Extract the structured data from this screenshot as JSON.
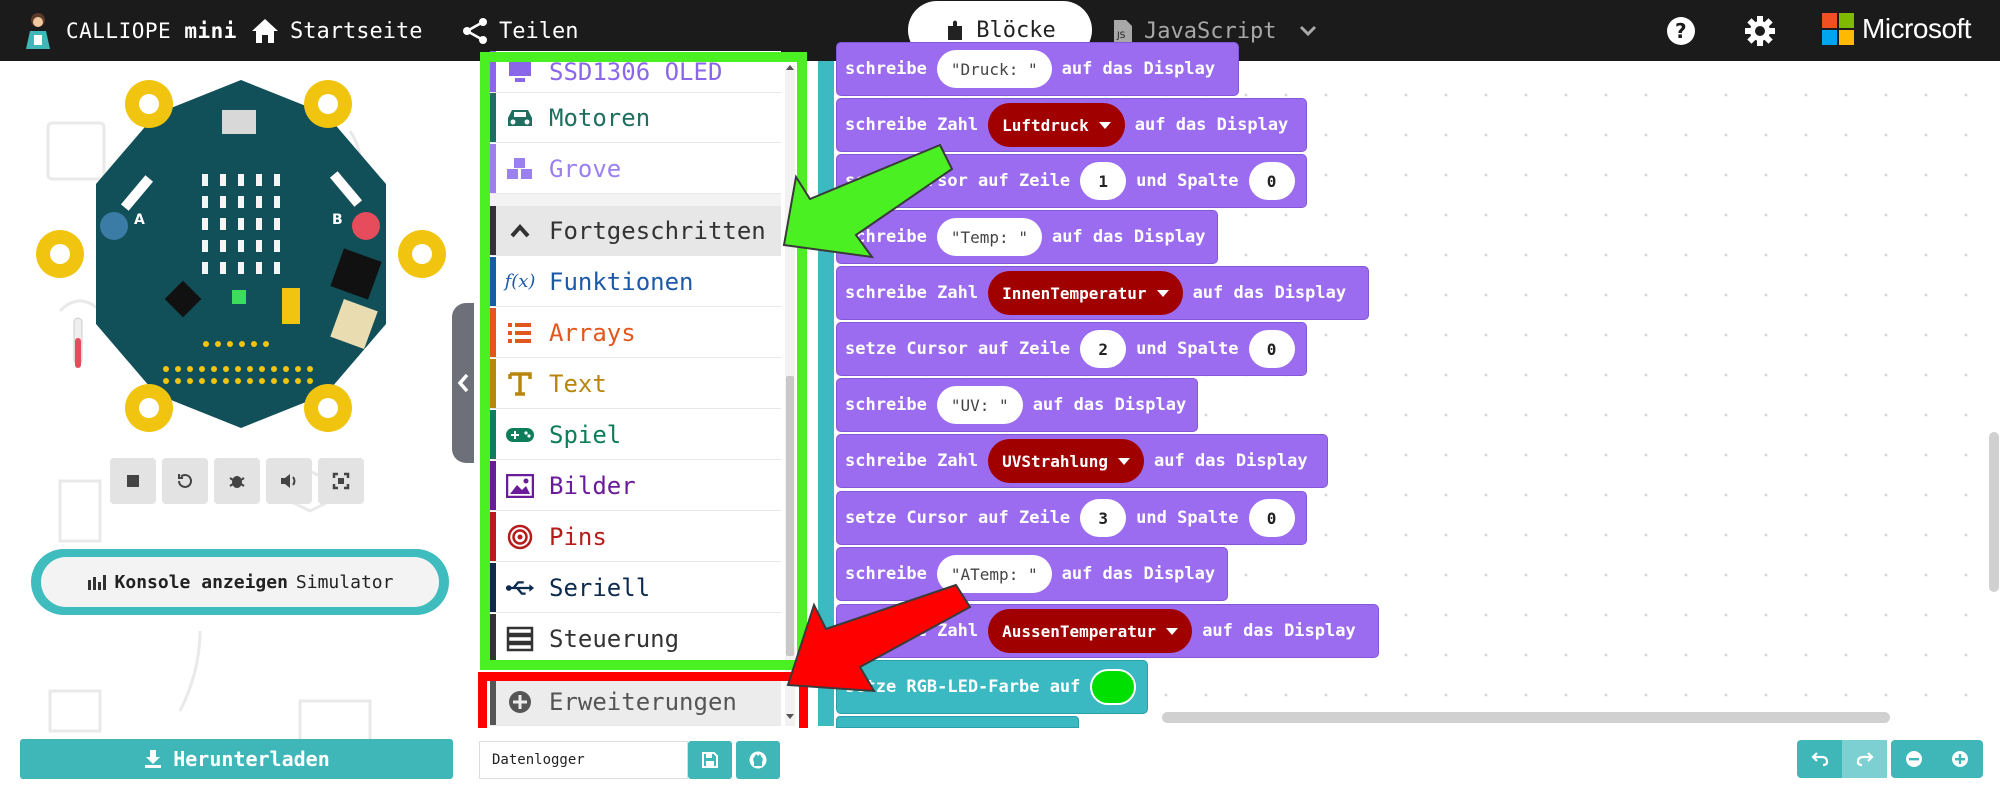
{
  "header": {
    "brand_prefix": "CALLIOPE",
    "brand_suffix": "mini",
    "home_label": "Startseite",
    "share_label": "Teilen",
    "tab_blocks": "Blöcke",
    "tab_javascript": "JavaScript",
    "microsoft_label": "Microsoft"
  },
  "simulator": {
    "console_label": "Konsole anzeigen",
    "console_suffix": "Simulator",
    "download_label": "Herunterladen"
  },
  "toolbox": {
    "items": [
      {
        "label": "SSD1306 OLED",
        "color": "#8a67e8",
        "icon": "display-icon"
      },
      {
        "label": "Motoren",
        "color": "#1f6e5f",
        "icon": "car-icon"
      },
      {
        "label": "Grove",
        "color": "#9b80f0",
        "icon": "cubes-icon"
      },
      {
        "label": "Fortgeschritten",
        "color": "#333333",
        "icon": "chevron-up-icon"
      },
      {
        "label": "Funktionen",
        "color": "#1c5aa8",
        "icon": "function-icon"
      },
      {
        "label": "Arrays",
        "color": "#e2571e",
        "icon": "list-icon"
      },
      {
        "label": "Text",
        "color": "#b8860b",
        "icon": "text-icon"
      },
      {
        "label": "Spiel",
        "color": "#0e7e5a",
        "icon": "gamepad-icon"
      },
      {
        "label": "Bilder",
        "color": "#6a1b9a",
        "icon": "image-icon"
      },
      {
        "label": "Pins",
        "color": "#b71c1c",
        "icon": "target-icon"
      },
      {
        "label": "Seriell",
        "color": "#0d2a4f",
        "icon": "usb-icon"
      },
      {
        "label": "Steuerung",
        "color": "#333333",
        "icon": "server-icon"
      },
      {
        "label": "Erweiterungen",
        "color": "#555555",
        "icon": "plus-circle-icon"
      }
    ]
  },
  "blocks": {
    "b1": {
      "prefix": "schreibe",
      "value": "\"Druck: \"",
      "suffix": "auf das Display"
    },
    "b2": {
      "prefix": "schreibe Zahl",
      "var": "Luftdruck",
      "suffix": "auf das Display"
    },
    "b3": {
      "prefix": "setze Cursor auf Zeile",
      "row": "1",
      "mid": "und Spalte",
      "col": "0"
    },
    "b4": {
      "prefix": "schreibe",
      "value": "\"Temp: \"",
      "suffix": "auf das Display"
    },
    "b5": {
      "prefix": "schreibe Zahl",
      "var": "InnenTemperatur",
      "suffix": "auf das Display"
    },
    "b6": {
      "prefix": "setze Cursor auf Zeile",
      "row": "2",
      "mid": "und Spalte",
      "col": "0"
    },
    "b7": {
      "prefix": "schreibe",
      "value": "\"UV: \"",
      "suffix": "auf das Display"
    },
    "b8": {
      "prefix": "schreibe Zahl",
      "var": "UVStrahlung",
      "suffix": "auf das Display"
    },
    "b9": {
      "prefix": "setze Cursor auf Zeile",
      "row": "3",
      "mid": "und Spalte",
      "col": "0"
    },
    "b10": {
      "prefix": "schreibe",
      "value": "\"ATemp: \"",
      "suffix": "auf das Display"
    },
    "b11": {
      "prefix": "schreibe Zahl",
      "var": "AussenTemperatur",
      "suffix": "auf das Display"
    },
    "b12": {
      "prefix": "setze RGB-LED-Farbe auf",
      "color": "#00e000"
    }
  },
  "footer": {
    "project_name": "Datenlogger"
  },
  "colors": {
    "header_bg": "#1b1b1b",
    "teal_accent": "#3fb6b7",
    "block_purple": "#9b6cf0",
    "variable_red": "#a00000",
    "highlight_green": "#4bf022",
    "highlight_red": "#ff0000"
  }
}
